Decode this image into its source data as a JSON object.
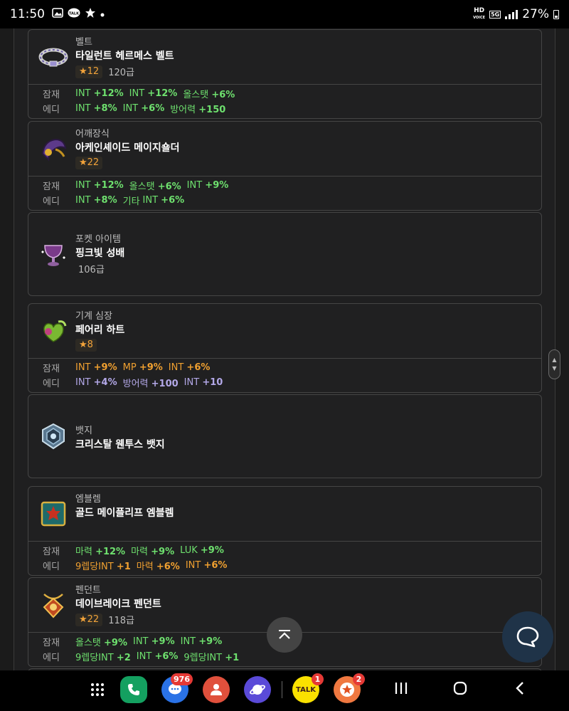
{
  "status_bar": {
    "time": "11:50",
    "talk_label": "TALK",
    "hd_label": "HD",
    "voice_label": "VOICE",
    "network_label": "5G",
    "battery": "27%"
  },
  "items": [
    {
      "category": "벨트",
      "name": "타일런트 헤르메스 벨트",
      "star": "12",
      "level": "120급",
      "icon": "belt-icon",
      "potential_label": "잠재",
      "potential": [
        {
          "stat": "INT",
          "value": "+12%",
          "color": "green"
        },
        {
          "stat": "INT",
          "value": "+12%",
          "color": "green"
        },
        {
          "stat": "올스탯",
          "value": "+6%",
          "color": "green"
        }
      ],
      "additional_label": "에디",
      "additional": [
        {
          "stat": "INT",
          "value": "+8%",
          "color": "green"
        },
        {
          "stat": "INT",
          "value": "+6%",
          "color": "green"
        },
        {
          "stat": "방어력",
          "value": "+150",
          "color": "green"
        }
      ]
    },
    {
      "category": "어깨장식",
      "name": "아케인셰이드 메이지숄더",
      "star": "22",
      "level": "",
      "icon": "shoulder-icon",
      "potential_label": "잠재",
      "potential": [
        {
          "stat": "INT",
          "value": "+12%",
          "color": "green"
        },
        {
          "stat": "올스탯",
          "value": "+6%",
          "color": "green"
        },
        {
          "stat": "INT",
          "value": "+9%",
          "color": "green"
        }
      ],
      "additional_label": "에디",
      "additional": [
        {
          "stat": "INT",
          "value": "+8%",
          "color": "green"
        },
        {
          "stat": "기타",
          "value": "",
          "color": "green"
        },
        {
          "stat": "INT",
          "value": "+6%",
          "color": "green"
        }
      ]
    },
    {
      "category": "포켓 아이템",
      "name": "핑크빛 성배",
      "star": "",
      "level": "106급",
      "icon": "pocket-icon"
    },
    {
      "category": "기계 심장",
      "name": "페어리 하트",
      "star": "8",
      "level": "",
      "icon": "heart-icon",
      "potential_label": "잠재",
      "potential": [
        {
          "stat": "INT",
          "value": "+9%",
          "color": "orange"
        },
        {
          "stat": "MP",
          "value": "+9%",
          "color": "orange"
        },
        {
          "stat": "INT",
          "value": "+6%",
          "color": "orange"
        }
      ],
      "additional_label": "에디",
      "additional": [
        {
          "stat": "INT",
          "value": "+4%",
          "color": "purple"
        },
        {
          "stat": "방어력",
          "value": "+100",
          "color": "purple"
        },
        {
          "stat": "INT",
          "value": "+10",
          "color": "purple"
        }
      ]
    },
    {
      "category": "뱃지",
      "name": "크리스탈 웬투스 뱃지",
      "star": "",
      "level": "",
      "icon": "badge-icon"
    },
    {
      "category": "엠블렘",
      "name": "골드 메이플리프 엠블렘",
      "star": "",
      "level": "",
      "icon": "emblem-icon",
      "potential_label": "잠재",
      "potential": [
        {
          "stat": "마력",
          "value": "+12%",
          "color": "green"
        },
        {
          "stat": "마력",
          "value": "+9%",
          "color": "green"
        },
        {
          "stat": "LUK",
          "value": "+9%",
          "color": "green"
        }
      ],
      "additional_label": "에디",
      "additional": [
        {
          "stat": "9렙당INT",
          "value": "+1",
          "color": "orange"
        },
        {
          "stat": "마력",
          "value": "+6%",
          "color": "orange"
        },
        {
          "stat": "INT",
          "value": "+6%",
          "color": "orange"
        }
      ]
    },
    {
      "category": "펜던트",
      "name": "데이브레이크 펜던트",
      "star": "22",
      "level": "118급",
      "icon": "pendant-icon",
      "potential_label": "잠재",
      "potential": [
        {
          "stat": "올스탯",
          "value": "+9%",
          "color": "green"
        },
        {
          "stat": "INT",
          "value": "+9%",
          "color": "green"
        },
        {
          "stat": "INT",
          "value": "+9%",
          "color": "green"
        }
      ],
      "additional_label": "에디",
      "additional": [
        {
          "stat": "9렙당INT",
          "value": "+2",
          "color": "green"
        },
        {
          "stat": "INT",
          "value": "+6%",
          "color": "green"
        },
        {
          "stat": "9렙당INT",
          "value": "+1",
          "color": "green"
        }
      ]
    }
  ],
  "nav": {
    "phone_badge": "",
    "messages_badge": "976",
    "kakaotalk_badge": "1",
    "kakaotalk_label": "TALK",
    "other_badge": "2"
  },
  "colors": {
    "green": "#6ee06e",
    "orange": "#f0a030",
    "purple": "#b3a8e8",
    "star": "#f2a33a"
  }
}
